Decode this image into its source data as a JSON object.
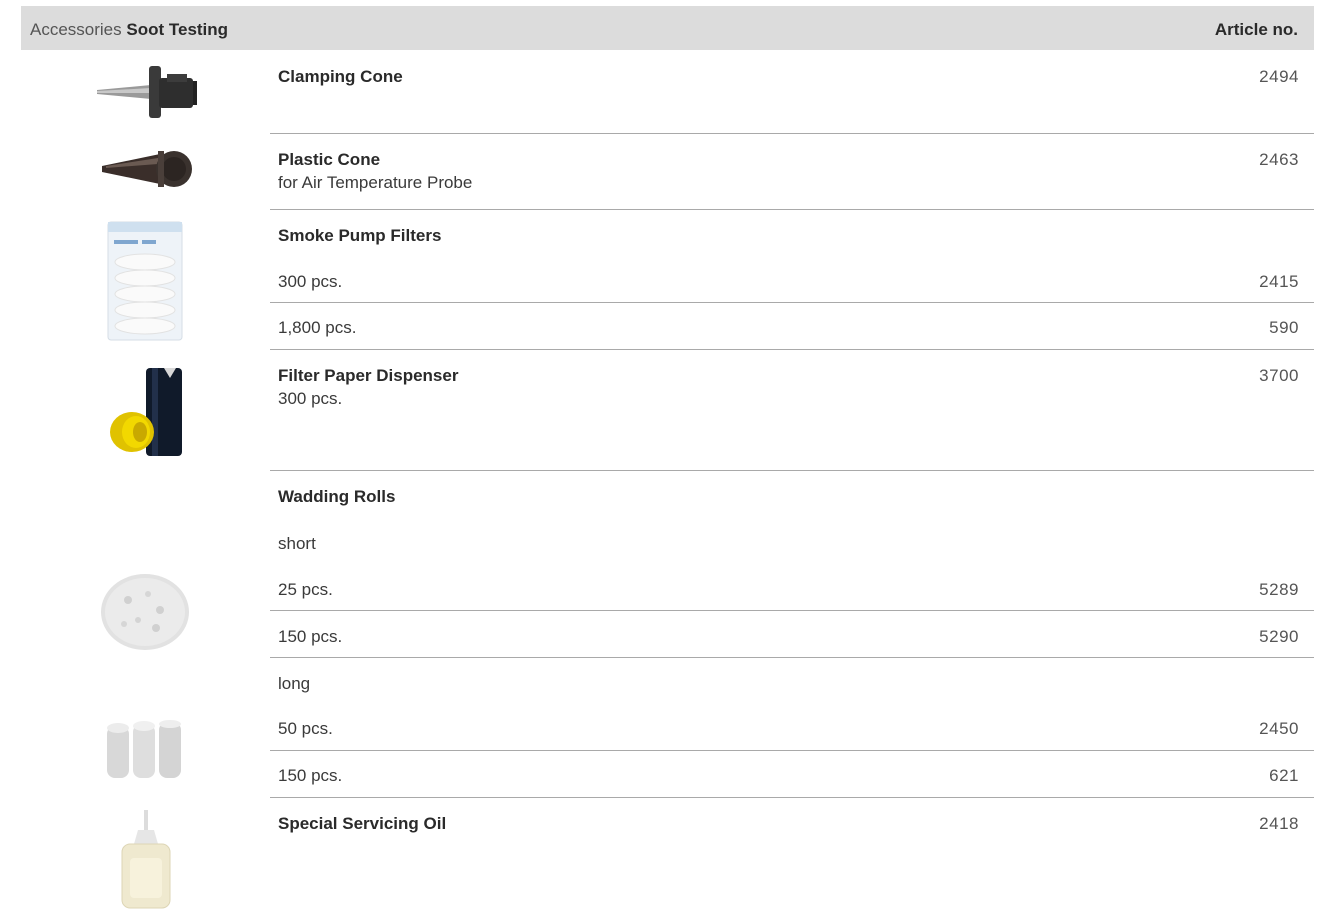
{
  "header": {
    "title_prefix": "Accessories",
    "title_bold": "Soot Testing",
    "article_no_label": "Article no."
  },
  "items": {
    "clamping_cone": {
      "name": "Clamping Cone",
      "article": "2494",
      "image": "clamping-cone-image"
    },
    "plastic_cone": {
      "name": "Plastic Cone",
      "sub": "for Air Temperature Probe",
      "article": "2463",
      "image": "plastic-cone-image"
    },
    "smoke_pump_filters": {
      "name": "Smoke Pump Filters",
      "image": "filter-bag-image",
      "variants": [
        {
          "label": "300 pcs.",
          "article": "2415"
        },
        {
          "label": "1,800 pcs.",
          "article": "590"
        }
      ]
    },
    "filter_paper_dispenser": {
      "name": "Filter Paper Dispenser",
      "sub": "300 pcs.",
      "article": "3700",
      "image": "dispenser-image"
    },
    "wadding_rolls": {
      "name": "Wadding Rolls",
      "short": {
        "label": "short",
        "image": "wadding-short-image",
        "variants": [
          {
            "label": "25 pcs.",
            "article": "5289"
          },
          {
            "label": "150 pcs.",
            "article": "5290"
          }
        ]
      },
      "long": {
        "label": "long",
        "image": "wadding-long-image",
        "variants": [
          {
            "label": "50 pcs.",
            "article": "2450"
          },
          {
            "label": "150 pcs.",
            "article": "621"
          }
        ]
      }
    },
    "special_servicing_oil": {
      "name": "Special Servicing Oil",
      "article": "2418",
      "image": "oil-bottle-image"
    }
  }
}
